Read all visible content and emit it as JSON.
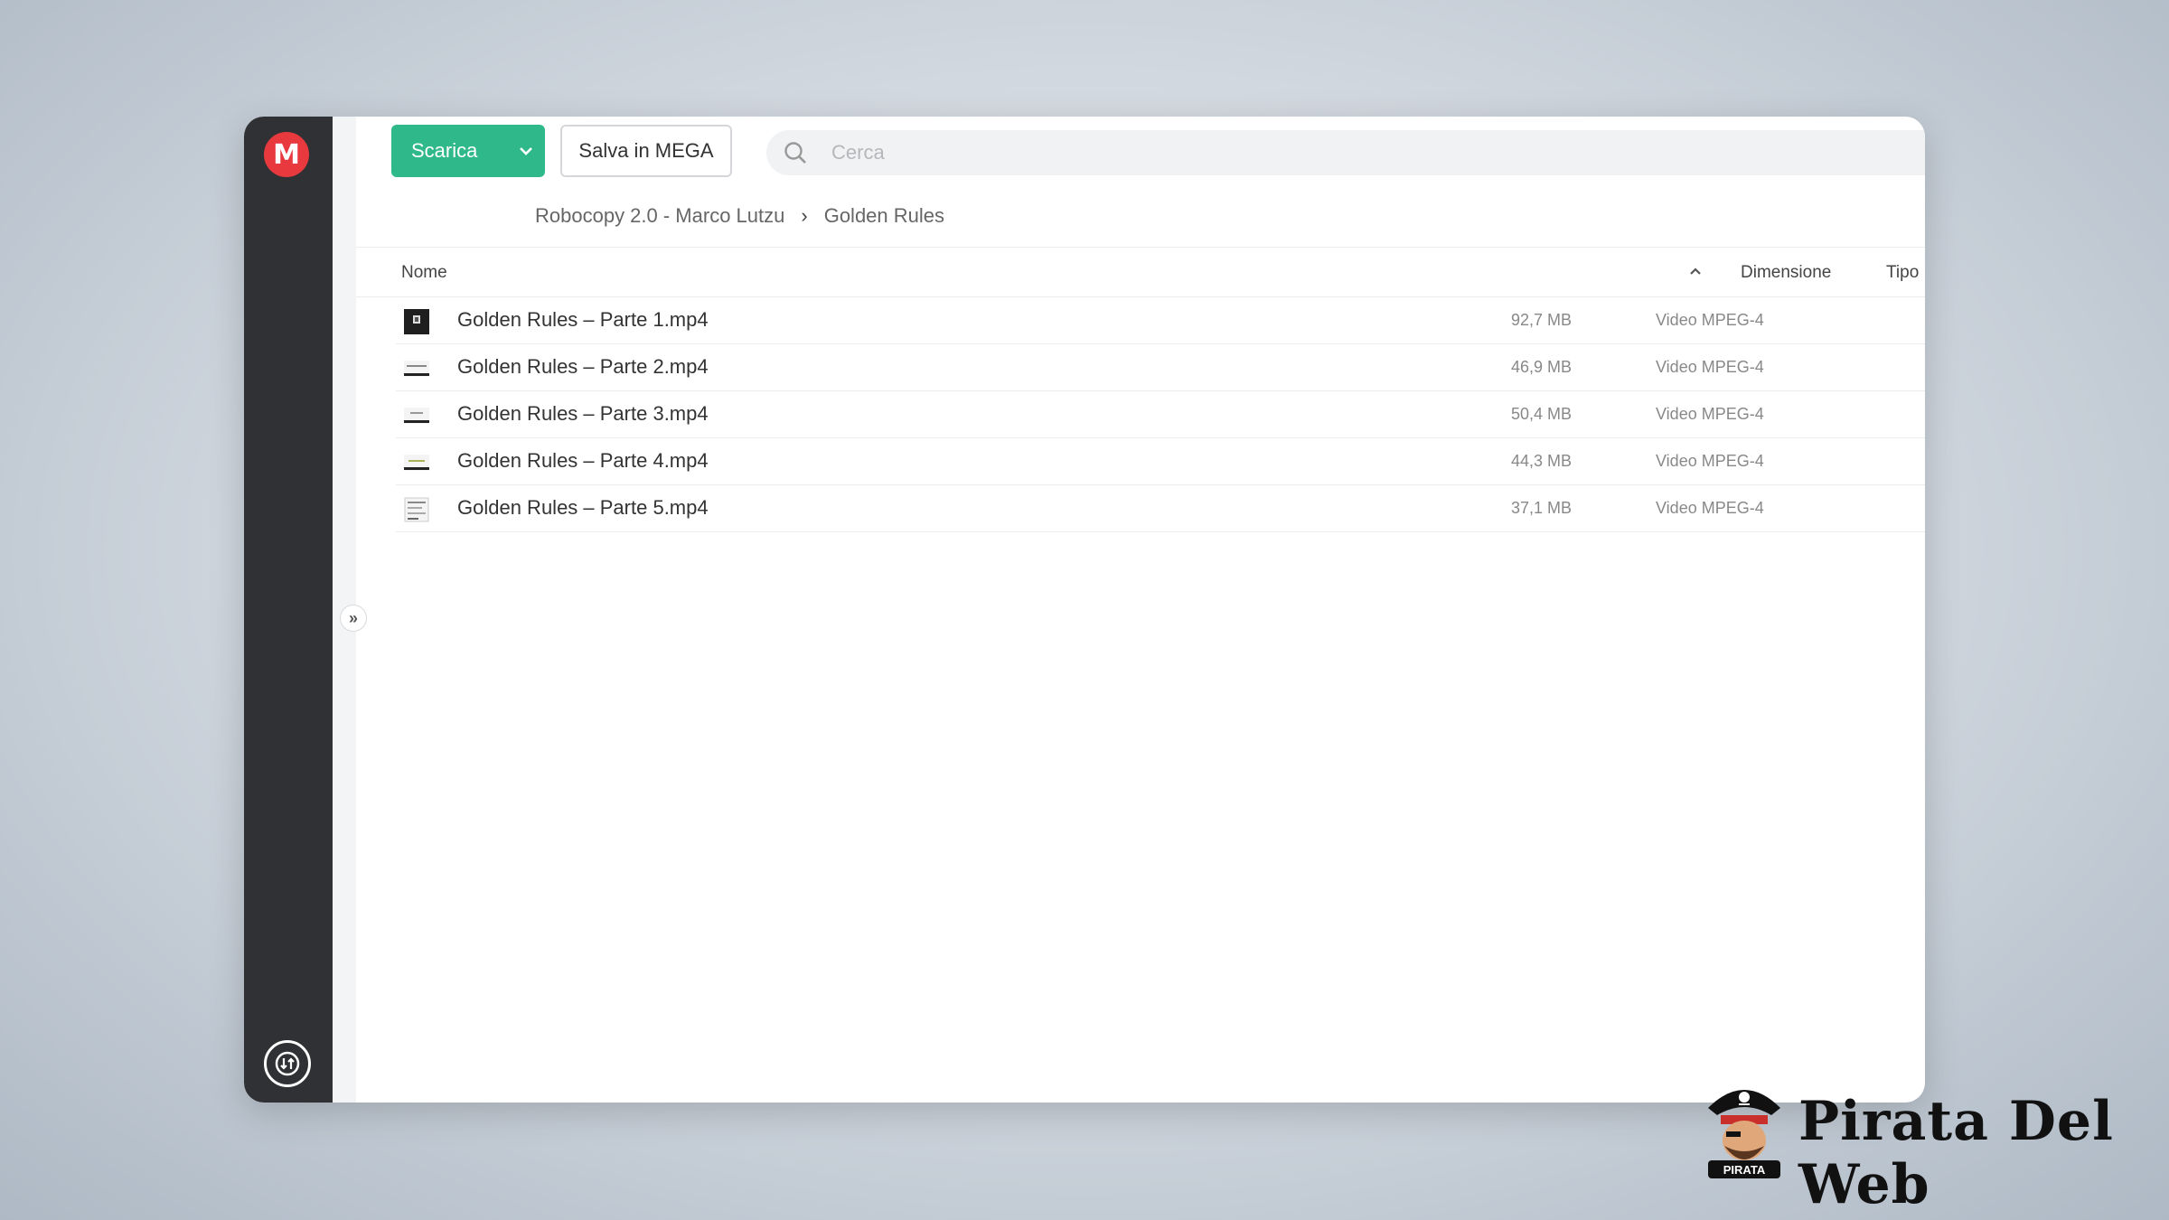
{
  "toolbar": {
    "download_label": "Scarica",
    "save_label": "Salva in MEGA"
  },
  "search": {
    "placeholder": "Cerca"
  },
  "breadcrumb": {
    "items": [
      "Robocopy 2.0 - Marco Lutzu",
      "Golden Rules"
    ]
  },
  "table": {
    "headers": {
      "name": "Nome",
      "size": "Dimensione",
      "type": "Tipo"
    },
    "rows": [
      {
        "name": "Golden Rules – Parte 1.mp4",
        "size": "92,7 MB",
        "type": "Video MPEG-4"
      },
      {
        "name": "Golden Rules – Parte 2.mp4",
        "size": "46,9 MB",
        "type": "Video MPEG-4"
      },
      {
        "name": "Golden Rules – Parte 3.mp4",
        "size": "50,4 MB",
        "type": "Video MPEG-4"
      },
      {
        "name": "Golden Rules – Parte 4.mp4",
        "size": "44,3 MB",
        "type": "Video MPEG-4"
      },
      {
        "name": "Golden Rules – Parte 5.mp4",
        "size": "37,1 MB",
        "type": "Video MPEG-4"
      }
    ]
  },
  "branding": {
    "logo_text": "M",
    "watermark_badge": "PIRATA",
    "watermark_text": "Pirata Del Web"
  },
  "colors": {
    "accent": "#2fb98a",
    "brand": "#e8393f",
    "sidebar": "#2f3134"
  },
  "icons": {
    "logo": "mega-logo-icon",
    "dropdown": "chevron-down-icon",
    "search": "search-icon",
    "expand": "double-chevron-right-icon",
    "sort": "chevron-up-icon",
    "sync": "transfer-icon"
  }
}
